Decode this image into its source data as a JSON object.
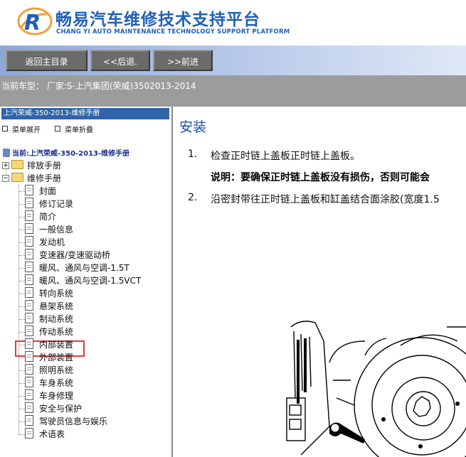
{
  "header": {
    "title_cn": "畅易汽车维修技术支持平台",
    "title_en": "CHANG YI AUTO MAINTENANCE TECHNOLOGY SUPPORT PLATFORM"
  },
  "nav": {
    "home_label": "返回主目录",
    "back_label": "<<后退.",
    "forward_label": ">>前进"
  },
  "vehicle": {
    "text": "当前车型： 厂家:S-上汽集团(荣威)3502013-2014"
  },
  "sidebar": {
    "manual_title": "上汽荣威-350-2013-维修手册",
    "expand_label": "菜单展开",
    "collapse_label": "菜单折叠",
    "current_label": "当前:上汽荣威-350-2013-维修手册",
    "folders": [
      "排放手册",
      "维修手册"
    ],
    "items": [
      "封面",
      "修订记录",
      "简介",
      "一般信息",
      "发动机",
      "变速器/变速驱动桥",
      "暖风、通风与空调-1.5T",
      "暖风、通风与空调-1.5VCT",
      "转向系统",
      "悬架系统",
      "制动系统",
      "传动系统",
      "内部装置",
      "外部装置",
      "照明系统",
      "车身系统",
      "车身修理",
      "安全与保护",
      "驾驶员信息与娱乐",
      "术语表"
    ],
    "selected_item": "发动机"
  },
  "content": {
    "section_title": "安装",
    "steps": [
      {
        "num": "1.",
        "text": "检查正时链上盖板正时链上盖板。"
      },
      {
        "num": "2.",
        "text": "沿密封带往正时链上盖板和缸盖结合面涂胶(宽度1.5"
      }
    ],
    "note": "说明：要确保正时链上盖板没有损伤，否则可能会"
  },
  "colors": {
    "brand_blue": "#1f5fb8",
    "sidebar_header": "#3064a8",
    "highlight_red": "#e23a3a"
  }
}
